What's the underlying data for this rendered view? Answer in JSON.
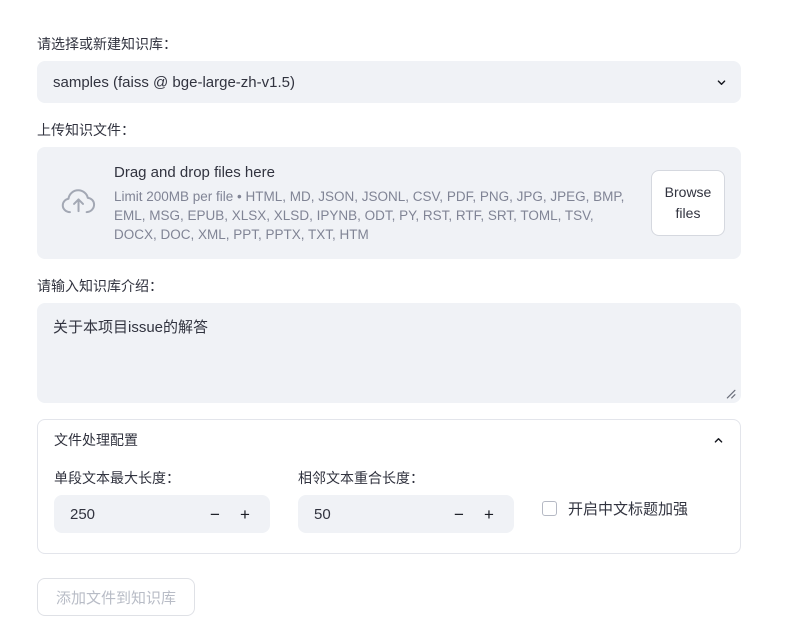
{
  "kb_select": {
    "label": "请选择或新建知识库：",
    "value": "samples (faiss @ bge-large-zh-v1.5)",
    "chevron": "chevron-down-icon"
  },
  "upload": {
    "label": "上传知识文件：",
    "icon": "cloud-upload-icon",
    "drag_title": "Drag and drop files here",
    "limit_text": "Limit 200MB per file • HTML, MD, JSON, JSONL, CSV, PDF, PNG, JPG, JPEG, BMP, EML, MSG, EPUB, XLSX, XLSD, IPYNB, ODT, PY, RST, RTF, SRT, TOML, TSV, DOCX, DOC, XML, PPT, PPTX, TXT, HTM",
    "browse_label": "Browse files"
  },
  "intro": {
    "label": "请输入知识库介绍：",
    "value": "关于本项目issue的解答",
    "placeholder": ""
  },
  "expander": {
    "title": "文件处理配置",
    "chevron": "chevron-up-icon",
    "chunk_size": {
      "label": "单段文本最大长度：",
      "value": "250",
      "minus": "−",
      "plus": "+"
    },
    "overlap_size": {
      "label": "相邻文本重合长度：",
      "value": "50",
      "minus": "−",
      "plus": "+"
    },
    "zh_title_enhance": {
      "label": "开启中文标题加强",
      "checked": false
    }
  },
  "submit": {
    "label": "添加文件到知识库",
    "disabled": true
  }
}
